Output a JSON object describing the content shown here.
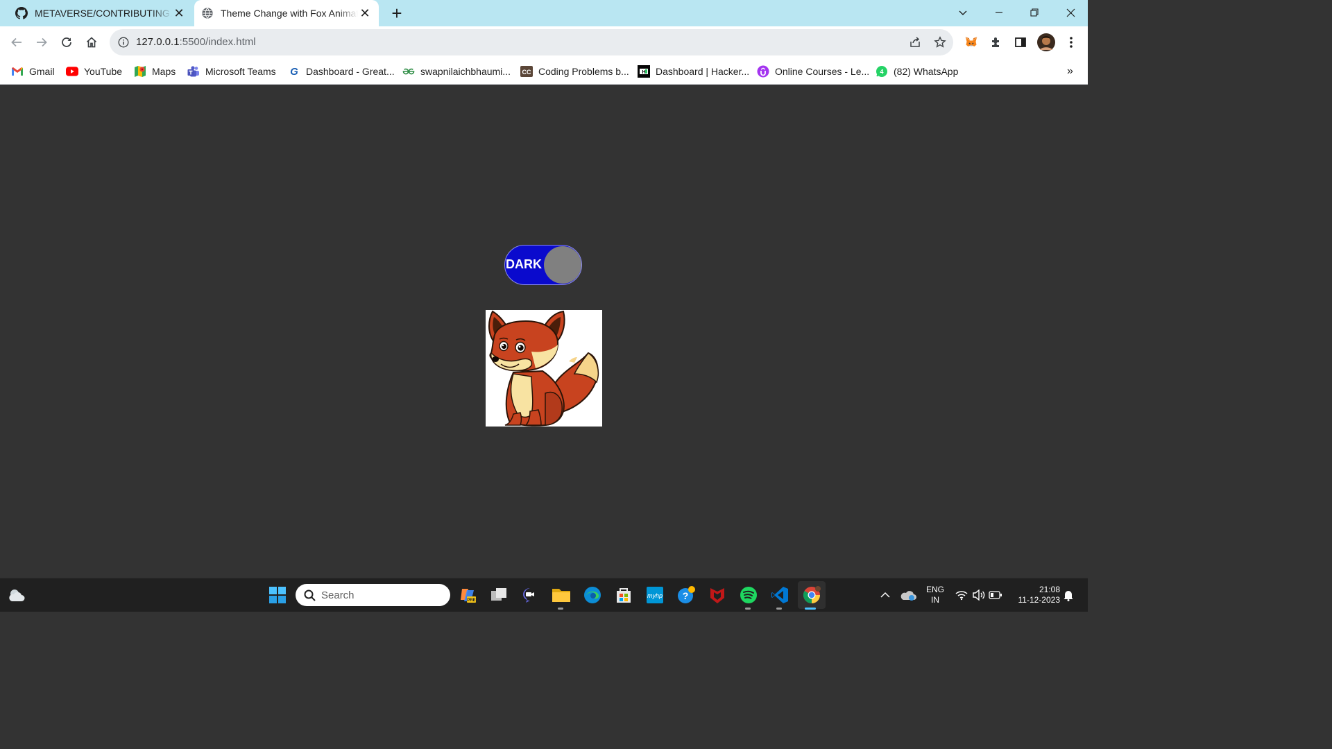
{
  "tabs": [
    {
      "title": "METAVERSE/CONTRIBUTING.md",
      "icon": "github-icon"
    },
    {
      "title": "Theme Change with Fox Animation",
      "icon": "globe-icon",
      "active": true
    }
  ],
  "new_tab": "+",
  "address": {
    "host": "127.0.0.1",
    "rest": ":5500/index.html"
  },
  "bookmarks": [
    {
      "label": "Gmail",
      "icon": "gmail-icon"
    },
    {
      "label": "YouTube",
      "icon": "youtube-icon"
    },
    {
      "label": "Maps",
      "icon": "maps-icon"
    },
    {
      "label": "Microsoft Teams",
      "icon": "teams-icon"
    },
    {
      "label": "Dashboard - Great...",
      "icon": "google-icon"
    },
    {
      "label": "swapnilaichbhaumi...",
      "icon": "geeksforgeeks-icon"
    },
    {
      "label": "Coding Problems b...",
      "icon": "codechef-icon"
    },
    {
      "label": "Dashboard | Hacker...",
      "icon": "hackerrank-icon"
    },
    {
      "label": "Online Courses - Le...",
      "icon": "udemy-icon"
    },
    {
      "label": "(82) WhatsApp",
      "icon": "whatsapp-icon"
    }
  ],
  "bookmarks_more": "»",
  "page": {
    "toggle_label": "DARK",
    "theme": "dark",
    "colors": {
      "background": "#333333",
      "toggle_track": "#0a0acd",
      "toggle_knob": "#808080"
    }
  },
  "taskbar": {
    "search_placeholder": "Search",
    "lang_line1": "ENG",
    "lang_line2": "IN",
    "time": "21:08",
    "date": "11-12-2023"
  }
}
